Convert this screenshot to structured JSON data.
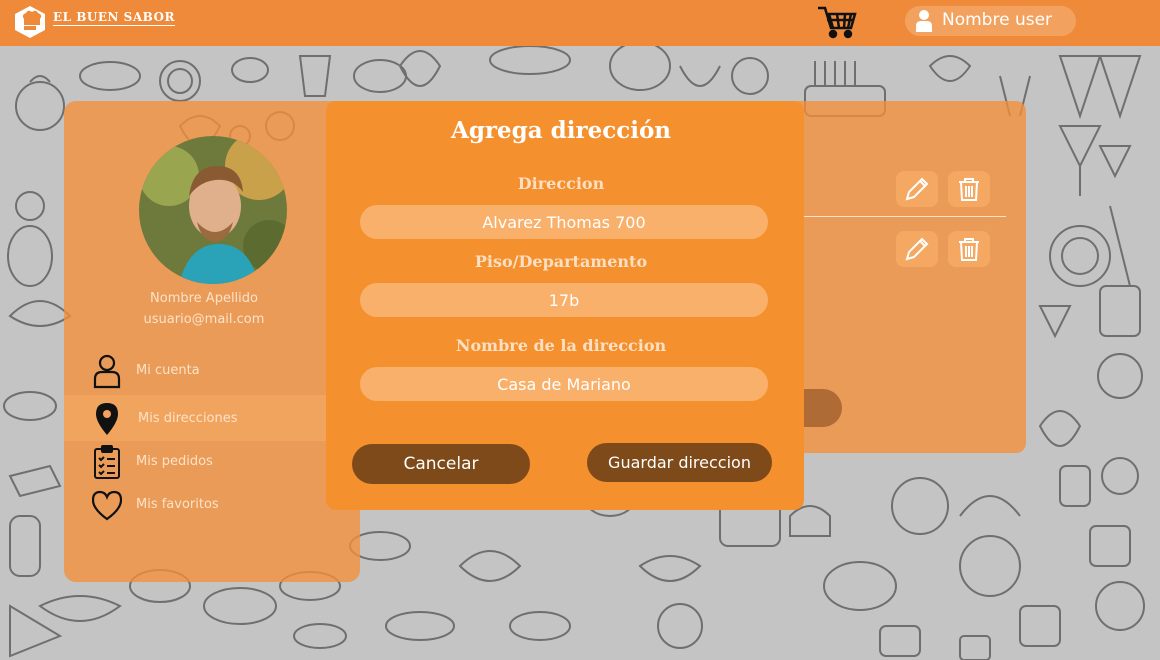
{
  "header": {
    "brand": "EL BUEN SABOR",
    "user_label": "Nombre user",
    "logo_icon": "chef-hat-icon",
    "cart_icon": "shopping-cart-icon",
    "user_icon": "user-icon"
  },
  "profile": {
    "name": "Nombre Apellido",
    "email": "usuario@mail.com",
    "menu": [
      {
        "label": "Mi cuenta",
        "icon": "person-outline-icon"
      },
      {
        "label": "Mis direcciones",
        "icon": "map-pin-icon"
      },
      {
        "label": "Mis pedidos",
        "icon": "clipboard-list-icon"
      },
      {
        "label": "Mis favoritos",
        "icon": "heart-outline-icon"
      }
    ]
  },
  "addresses": {
    "edit_icon": "pencil-icon",
    "delete_icon": "trash-icon"
  },
  "modal": {
    "title": "Agrega dirección",
    "fields": [
      {
        "label": "Direccion",
        "value": "Alvarez Thomas 700"
      },
      {
        "label": "Piso/Departamento",
        "value": "17b"
      },
      {
        "label": "Nombre de la direccion",
        "value": "Casa de Mariano"
      }
    ],
    "cancel_label": "Cancelar",
    "save_label": "Guardar direccion"
  },
  "colors": {
    "header": "#ee8a3a",
    "modal": "#f5902f",
    "button": "#7f4a19",
    "input": "#f9b06b"
  }
}
